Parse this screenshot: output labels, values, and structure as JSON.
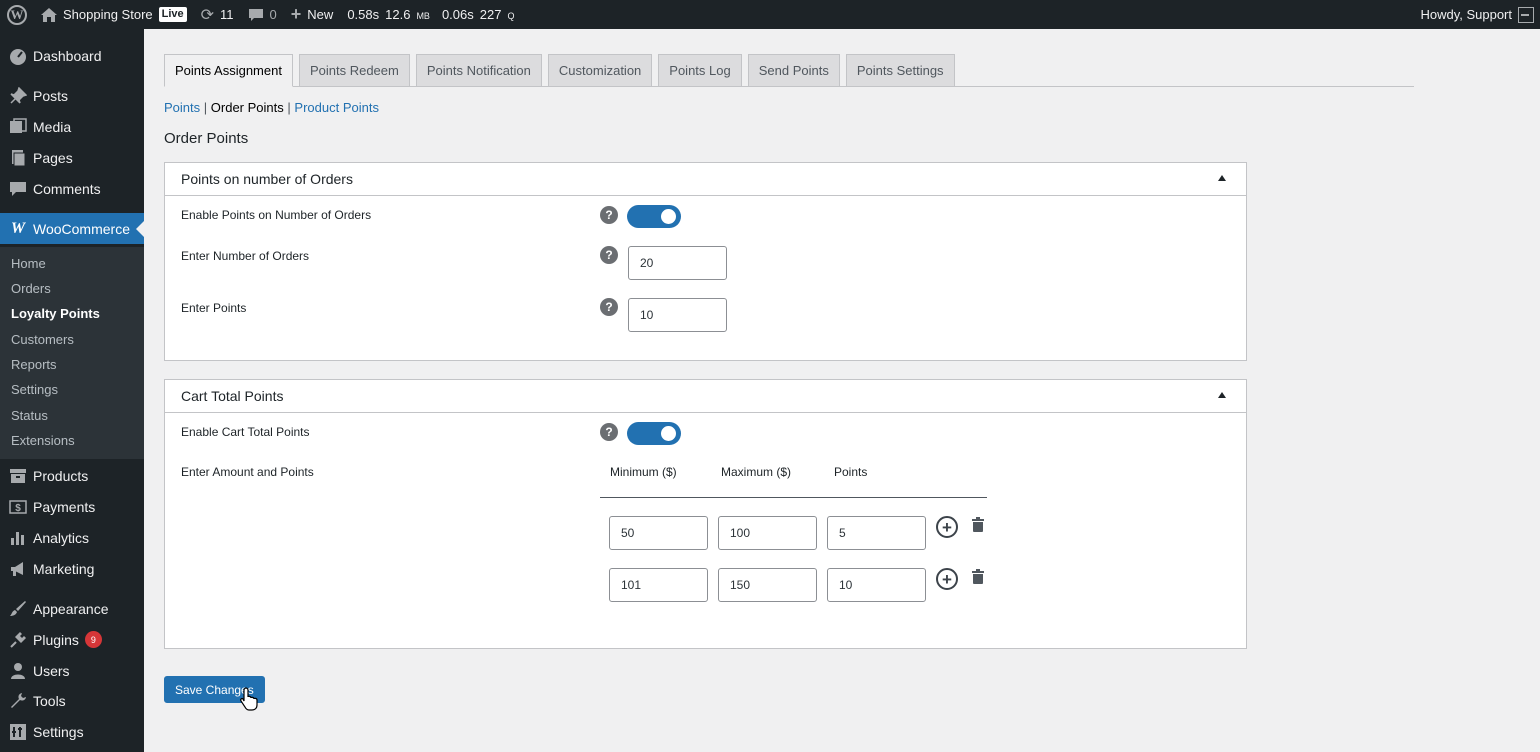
{
  "adminbar": {
    "site_name": "Shopping Store",
    "live_badge": "Live",
    "updates_count": "11",
    "comments_count": "0",
    "new_label": "New",
    "perf_time": "0.58s",
    "perf_mem_value": "12.6",
    "perf_mem_unit": "MB",
    "perf_query_time": "0.06s",
    "perf_queries_value": "227",
    "perf_queries_unit": "Q",
    "howdy": "Howdy, Support"
  },
  "sidebar": {
    "items": [
      {
        "label": "Dashboard",
        "icon": "dashboard-icon"
      },
      {
        "label": "Posts",
        "icon": "pin-icon"
      },
      {
        "label": "Media",
        "icon": "media-icon"
      },
      {
        "label": "Pages",
        "icon": "pages-icon"
      },
      {
        "label": "Comments",
        "icon": "comment-icon"
      },
      {
        "label": "WooCommerce",
        "icon": "woocommerce-icon"
      },
      {
        "label": "Products",
        "icon": "archive-icon"
      },
      {
        "label": "Payments",
        "icon": "dollar-icon"
      },
      {
        "label": "Analytics",
        "icon": "bar-chart-icon"
      },
      {
        "label": "Marketing",
        "icon": "megaphone-icon"
      },
      {
        "label": "Appearance",
        "icon": "brush-icon"
      },
      {
        "label": "Plugins",
        "icon": "plug-icon"
      },
      {
        "label": "Users",
        "icon": "user-icon"
      },
      {
        "label": "Tools",
        "icon": "wrench-icon"
      },
      {
        "label": "Settings",
        "icon": "settings-icon"
      }
    ],
    "plugins_badge": "9",
    "submenu": [
      "Home",
      "Orders",
      "Loyalty Points",
      "Customers",
      "Reports",
      "Settings",
      "Status",
      "Extensions"
    ]
  },
  "tabs": [
    "Points Assignment",
    "Points Redeem",
    "Points Notification",
    "Customization",
    "Points Log",
    "Send Points",
    "Points Settings"
  ],
  "subnav": {
    "points": "Points",
    "order_points": "Order Points",
    "product_points": "Product Points",
    "sep": "|"
  },
  "page_title": "Order Points",
  "orders_panel": {
    "title": "Points on number of Orders",
    "enable_label": "Enable Points on Number of Orders",
    "enabled": true,
    "orders_label": "Enter Number of Orders",
    "orders_value": "20",
    "points_label": "Enter Points",
    "points_value": "10"
  },
  "cart_panel": {
    "title": "Cart Total Points",
    "enable_label": "Enable Cart Total Points",
    "enabled": true,
    "amount_label": "Enter Amount and Points",
    "col_min": "Minimum ($)",
    "col_max": "Maximum ($)",
    "col_points": "Points",
    "rows": [
      {
        "min": "50",
        "max": "100",
        "points": "5"
      },
      {
        "min": "101",
        "max": "150",
        "points": "10"
      }
    ]
  },
  "help_glyph": "?",
  "save_label": "Save Changes",
  "colors": {
    "accent": "#2271b1",
    "admin_dark": "#1d2327",
    "submenu_bg": "#2c3338",
    "badge": "#d63638"
  }
}
